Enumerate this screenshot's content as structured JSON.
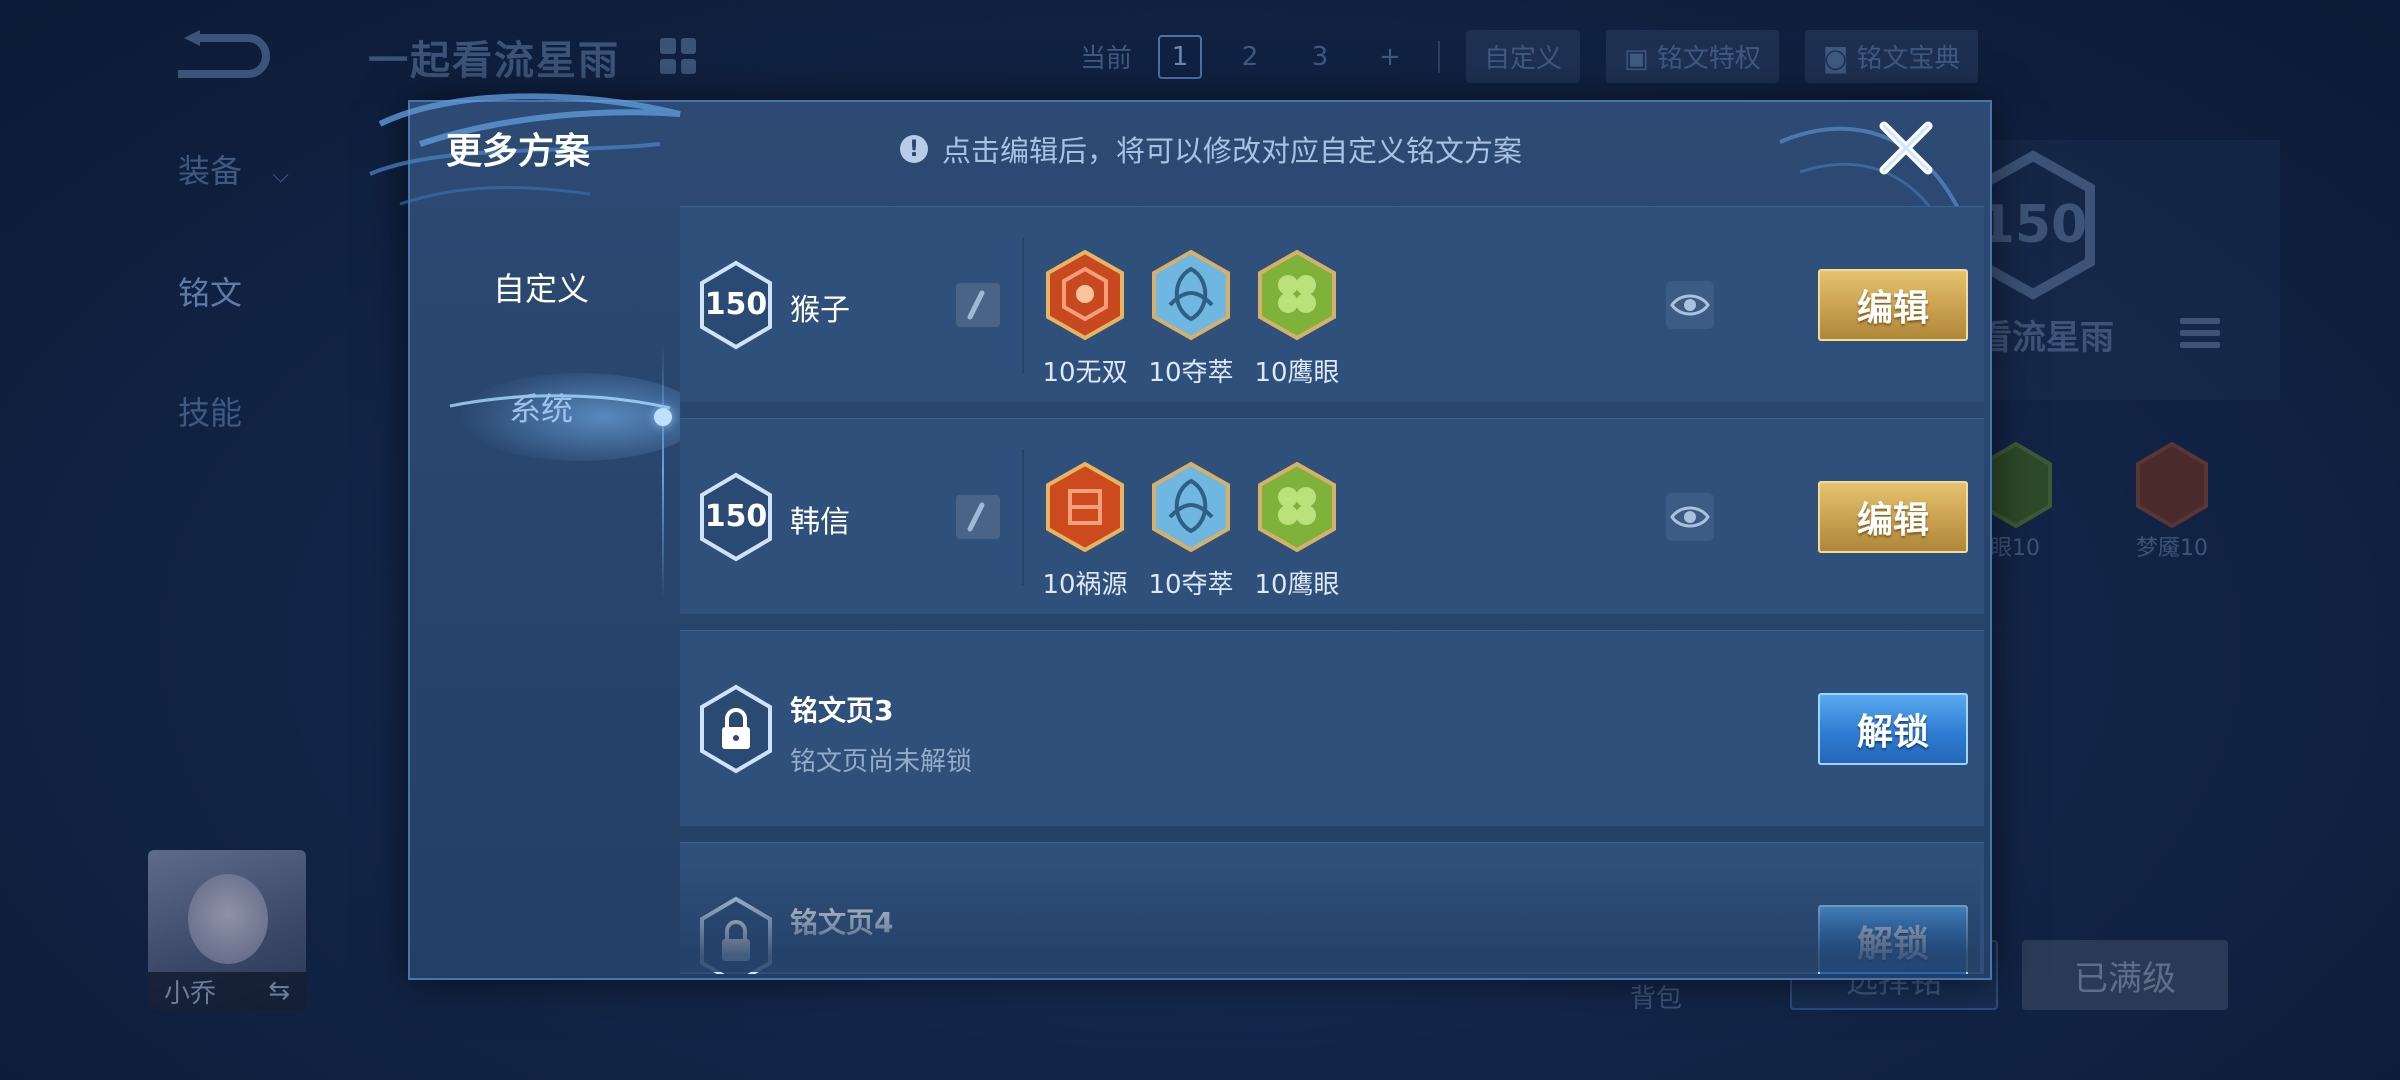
{
  "background": {
    "title": "一起看流星雨",
    "toolbar": {
      "current_label": "当前",
      "pages": [
        "1",
        "2",
        "3",
        "+"
      ],
      "custom_label": "自定义",
      "privilege_label": "铭文特权",
      "codex_label": "铭文宝典"
    },
    "side": {
      "equipment": "装备",
      "inscription": "铭文",
      "skills": "技能"
    },
    "right_panel": {
      "level": "150",
      "name": "看流星雨",
      "rune_labels": [
        "眼10",
        "梦魇10"
      ]
    },
    "hero": {
      "name": "小乔",
      "swap_icon": "⇆"
    },
    "bag_label": "背包",
    "select_button": "选择铭",
    "maxed_button": "已满级"
  },
  "modal": {
    "title": "更多方案",
    "hint": "点击编辑后，将可以修改对应自定义铭文方案",
    "hint_icon": "!",
    "tabs": {
      "custom": "自定义",
      "system": "系统"
    },
    "rows": [
      {
        "level": "150",
        "name": "猴子",
        "runes": [
          {
            "label": "10无双",
            "color": "#c8481f"
          },
          {
            "label": "10夺萃",
            "color": "#6fb6e0"
          },
          {
            "label": "10鹰眼",
            "color": "#7fb23a"
          }
        ],
        "button": "编辑"
      },
      {
        "level": "150",
        "name": "韩信",
        "runes": [
          {
            "label": "10祸源",
            "color": "#cc4a1e"
          },
          {
            "label": "10夺萃",
            "color": "#6fb6e0"
          },
          {
            "label": "10鹰眼",
            "color": "#7fb23a"
          }
        ],
        "button": "编辑"
      },
      {
        "name": "铭文页3",
        "status": "铭文页尚未解锁",
        "button": "解锁"
      },
      {
        "name": "铭文页4",
        "button": "解锁"
      }
    ]
  },
  "colors": {
    "gold_button": "#c9a050",
    "blue_button": "#2f7dd4",
    "modal_bg": "#2c4a73"
  }
}
